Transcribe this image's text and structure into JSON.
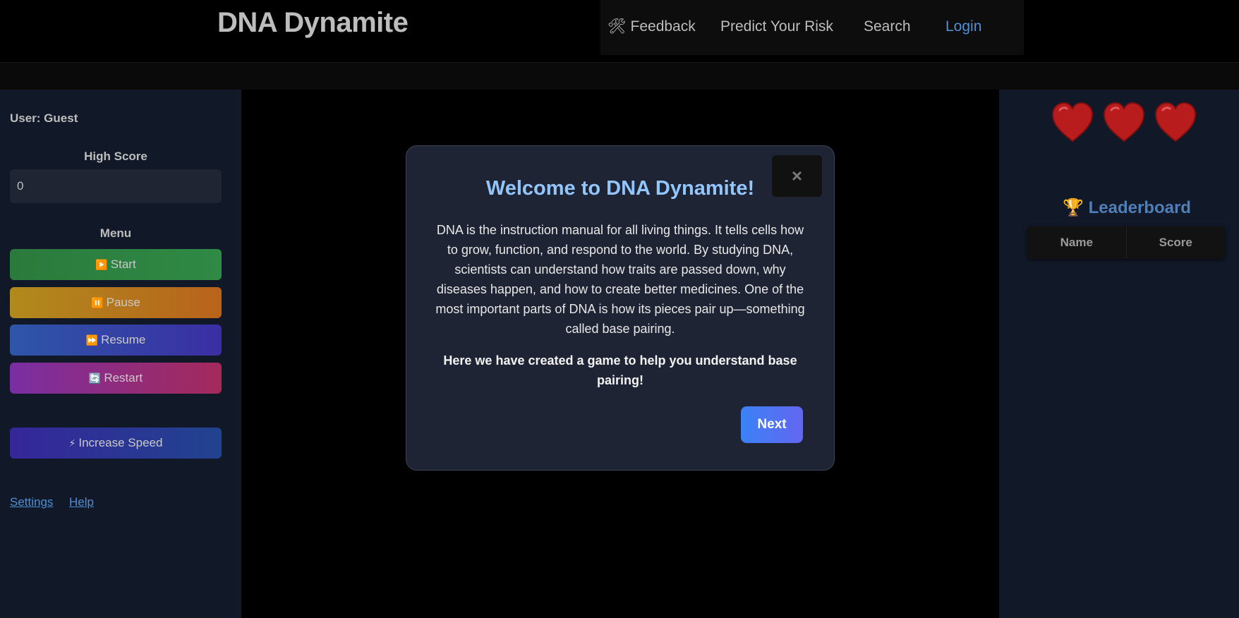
{
  "header": {
    "brand": "DNA Dynamite",
    "nav": {
      "feedback_icon": "🛠",
      "feedback": "Feedback",
      "predict": "Predict Your Risk",
      "search": "Search",
      "login": "Login"
    }
  },
  "sidebar": {
    "user": "User: Guest",
    "high_score_label": "High Score",
    "high_score_value": "0",
    "menu_label": "Menu",
    "buttons": {
      "start_icon": "▶️",
      "start": "Start",
      "pause_icon": "⏸️",
      "pause": "Pause",
      "resume_icon": "⏩",
      "resume": "Resume",
      "restart_icon": "🔄",
      "restart": "Restart",
      "speed_icon": "⚡",
      "speed": "Increase Speed"
    },
    "links": {
      "settings": "Settings",
      "help": "Help"
    }
  },
  "right_panel": {
    "lives": 3,
    "leaderboard_icon": "🏆",
    "leaderboard_title": "Leaderboard",
    "columns": [
      "Name",
      "Score"
    ]
  },
  "modal": {
    "close_label": "×",
    "title": "Welcome to DNA Dynamite!",
    "body": "DNA is the instruction manual for all living things. It tells cells how to grow, function, and respond to the world. By studying DNA, scientists can understand how traits are passed down, why diseases happen, and how to create better medicines. One of the most important parts of DNA is how its pieces pair up—something called base pairing.",
    "emphasis": "Here we have created a game to help you understand base pairing!",
    "next_label": "Next"
  },
  "colors": {
    "accent_blue": "#4f8fd6",
    "modal_title": "#93c5fd",
    "heart": "#b91c1c"
  }
}
